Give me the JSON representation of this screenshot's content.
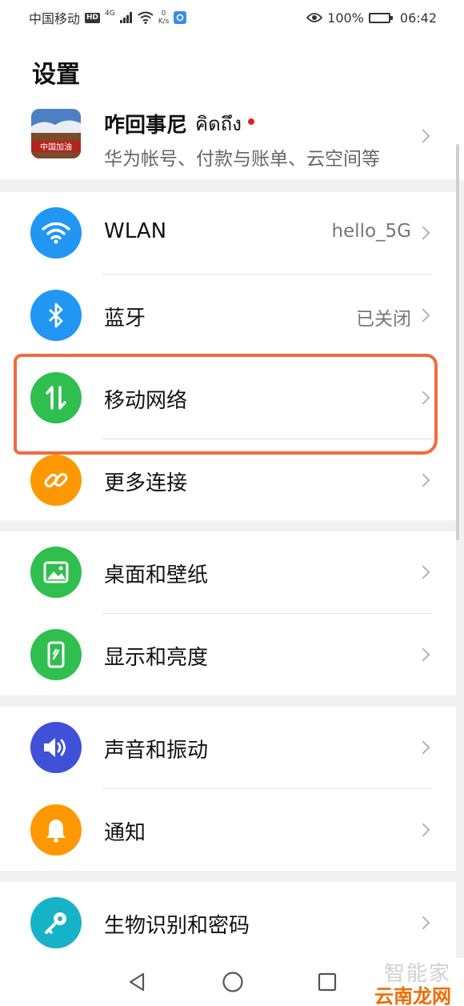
{
  "status_bar": {
    "carrier": "中国移动",
    "hd": "HD",
    "signal_type": "4G",
    "net_speed_value": "0",
    "net_speed_unit": "K/s",
    "battery": "100%",
    "time": "06:42"
  },
  "page": {
    "title": "设置"
  },
  "account": {
    "name": "咋回事尼",
    "name_extra": "คิดถึง",
    "subtitle": "华为帐号、付款与账单、云空间等",
    "avatar_text": "中国加油"
  },
  "groups": [
    {
      "items": [
        {
          "label": "WLAN",
          "value": "hello_5G",
          "icon": "wifi-icon",
          "color": "#2196f3"
        },
        {
          "label": "蓝牙",
          "value": "已关闭",
          "icon": "bluetooth-icon",
          "color": "#2196f3"
        },
        {
          "label": "移动网络",
          "value": "",
          "icon": "mobile-data-icon",
          "color": "#2fbf4f"
        },
        {
          "label": "更多连接",
          "value": "",
          "icon": "link-icon",
          "color": "#ff9800"
        }
      ]
    },
    {
      "items": [
        {
          "label": "桌面和壁纸",
          "value": "",
          "icon": "wallpaper-icon",
          "color": "#2fbf4f"
        },
        {
          "label": "显示和亮度",
          "value": "",
          "icon": "display-icon",
          "color": "#2fbf4f"
        }
      ]
    },
    {
      "items": [
        {
          "label": "声音和振动",
          "value": "",
          "icon": "sound-icon",
          "color": "#3f51d8"
        },
        {
          "label": "通知",
          "value": "",
          "icon": "bell-icon",
          "color": "#ff9800"
        }
      ]
    },
    {
      "items": [
        {
          "label": "生物识别和密码",
          "value": "",
          "icon": "key-icon",
          "color": "#16b3c8"
        }
      ]
    }
  ],
  "watermark": {
    "top": "智能家",
    "bottom": "云南龙网"
  }
}
